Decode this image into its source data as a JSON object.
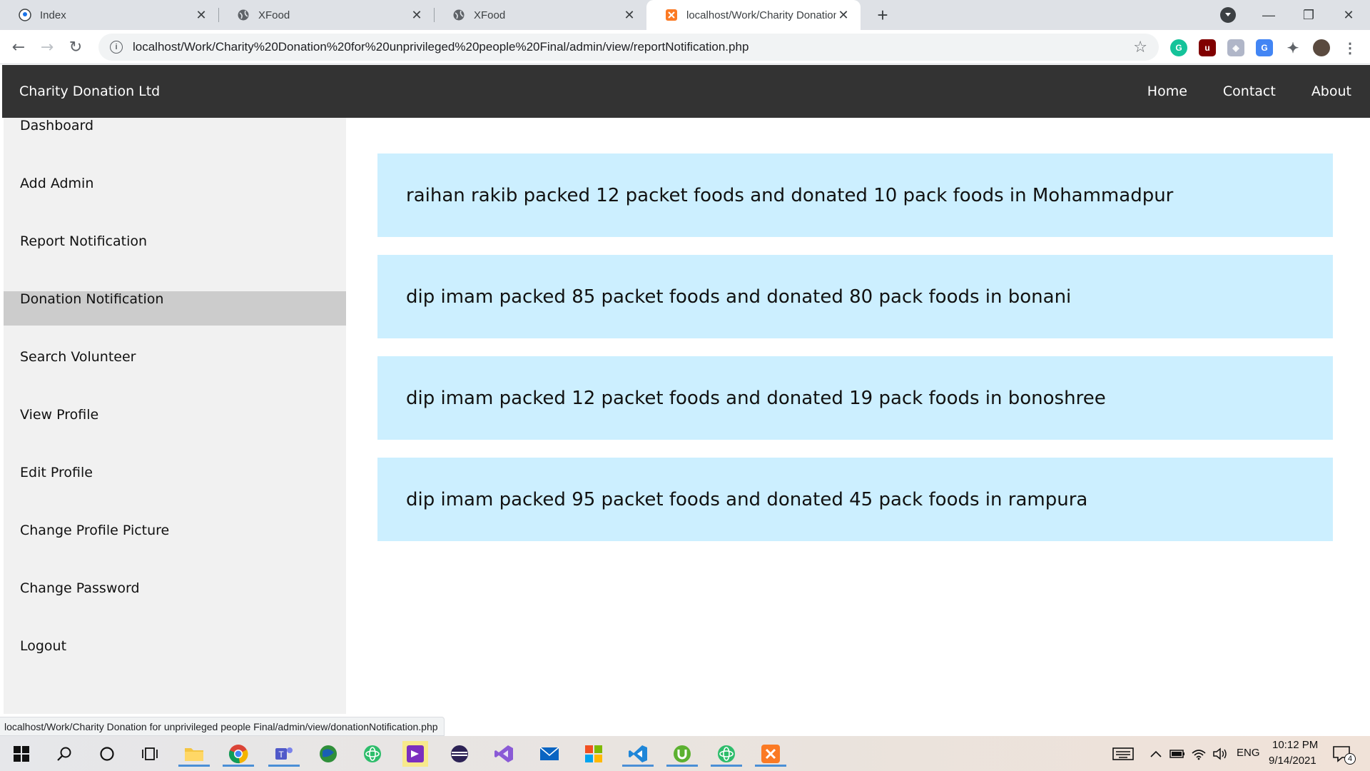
{
  "browser": {
    "tabs": [
      {
        "label": "Index",
        "icon": "github-icon"
      },
      {
        "label": "XFood",
        "icon": "globe-icon"
      },
      {
        "label": "XFood",
        "icon": "globe-icon"
      },
      {
        "label": "localhost/Work/Charity Donation",
        "icon": "xampp-icon",
        "active": true
      }
    ],
    "url": "localhost/Work/Charity%20Donation%20for%20unprivileged%20people%20Final/admin/view/reportNotification.php",
    "status_url": "localhost/Work/Charity Donation for unprivileged people Final/admin/view/donationNotification.php"
  },
  "header": {
    "brand": "Charity Donation Ltd",
    "nav": [
      "Home",
      "Contact",
      "About"
    ]
  },
  "sidebar": {
    "items": [
      {
        "label": "Dashboard"
      },
      {
        "label": "Add Admin"
      },
      {
        "label": "Report Notification"
      },
      {
        "label": "Donation Notification",
        "hover": true
      },
      {
        "label": "Search Volunteer"
      },
      {
        "label": "View Profile"
      },
      {
        "label": "Edit Profile"
      },
      {
        "label": "Change Profile Picture"
      },
      {
        "label": "Change Password"
      },
      {
        "label": "Logout"
      }
    ]
  },
  "notifications": [
    "raihan rakib packed 12 packet foods and donated 10 pack foods in Mohammadpur",
    "dip imam packed 85 packet foods and donated 80 pack foods in bonani",
    "dip imam packed 12 packet foods and donated 19 pack foods in bonoshree",
    "dip imam packed 95 packet foods and donated 45 pack foods in rampura"
  ],
  "colors": {
    "header_bg": "#333333",
    "sidebar_bg": "#f1f1f1",
    "sidebar_hover": "#cccccc",
    "notification_bg": "#ccefff"
  },
  "taskbar": {
    "language": "ENG",
    "time": "10:12 PM",
    "date": "9/14/2021",
    "notification_count": "4"
  }
}
